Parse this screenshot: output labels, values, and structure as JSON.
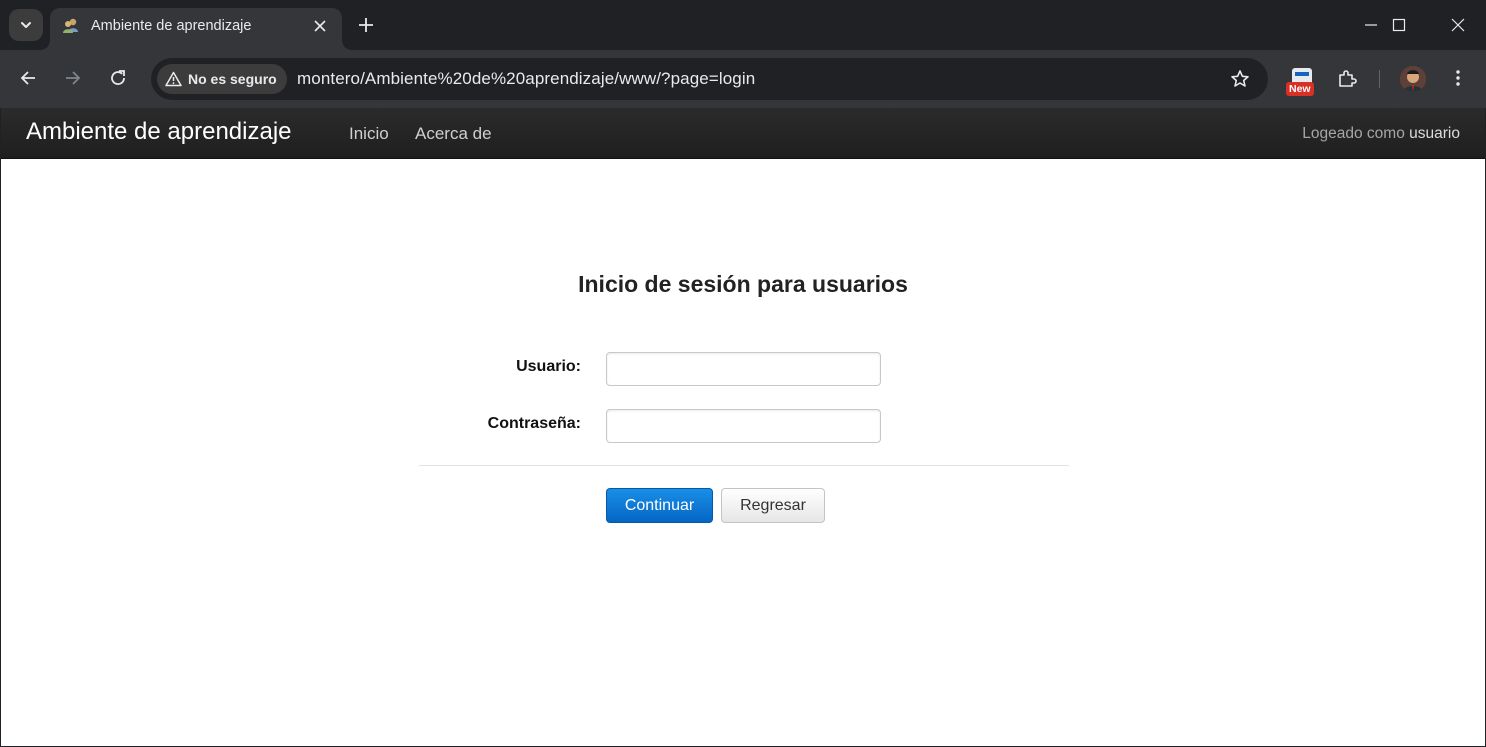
{
  "browser": {
    "tab_title": "Ambiente de aprendizaje",
    "security_label": "No es seguro",
    "url": "montero/Ambiente%20de%20aprendizaje/www/?page=login",
    "extension_badge": "New"
  },
  "navbar": {
    "brand": "Ambiente de aprendizaje",
    "links": [
      "Inicio",
      "Acerca de"
    ],
    "logged_prefix": "Logeado como",
    "logged_user": "usuario"
  },
  "login": {
    "title": "Inicio de sesión para usuarios",
    "username_label": "Usuario:",
    "username_value": "",
    "password_label": "Contraseña:",
    "password_value": "",
    "submit_label": "Continuar",
    "back_label": "Regresar"
  },
  "colors": {
    "primary_button": "#0a78d6",
    "navbar": "#252525"
  }
}
